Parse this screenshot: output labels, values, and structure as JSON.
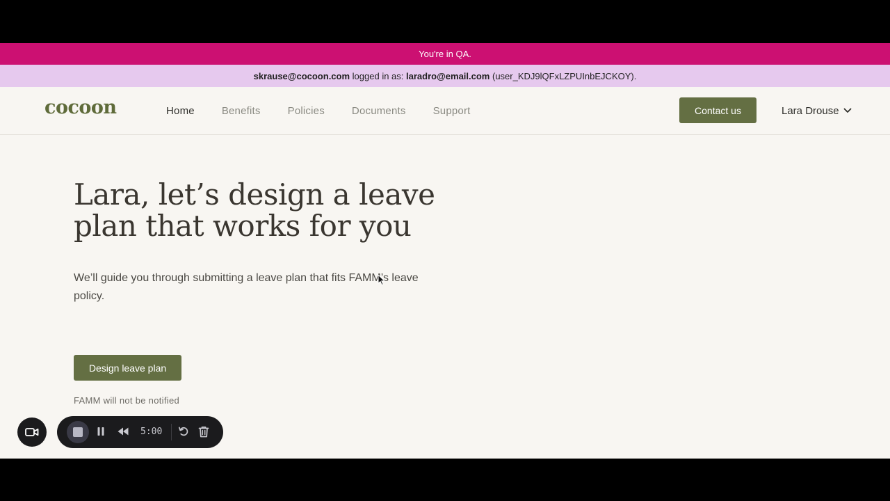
{
  "banners": {
    "qa_text": "You're in QA.",
    "impersonation": {
      "admin_email": "skrause@cocoon.com",
      "logged_in_as_label": "logged in as:",
      "user_email": "laradro@email.com",
      "user_id": "(user_KDJ9lQFxLZPUInbEJCKOY)."
    }
  },
  "nav": {
    "logo": "cocoon",
    "links": [
      {
        "label": "Home",
        "active": true
      },
      {
        "label": "Benefits",
        "active": false
      },
      {
        "label": "Policies",
        "active": false
      },
      {
        "label": "Documents",
        "active": false
      },
      {
        "label": "Support",
        "active": false
      }
    ],
    "contact_label": "Contact us",
    "user_name": "Lara Drouse"
  },
  "hero": {
    "headline": "Lara, let’s design a leave plan that works for you",
    "subtext": "We’ll guide you through submitting a leave plan that fits FAMM’s leave policy.",
    "cta_label": "Design leave plan",
    "note": "FAMM will not be notified"
  },
  "recorder": {
    "time": "5:00"
  },
  "colors": {
    "brand": "#646f43",
    "qa_banner": "#cc1072",
    "impersonation_banner": "#e6c9ee",
    "background": "#f8f6f2"
  },
  "icons": [
    "video-camera-icon",
    "stop-icon",
    "pause-icon",
    "rewind-icon",
    "restart-icon",
    "trash-icon",
    "chevron-down-icon",
    "cursor-icon"
  ]
}
